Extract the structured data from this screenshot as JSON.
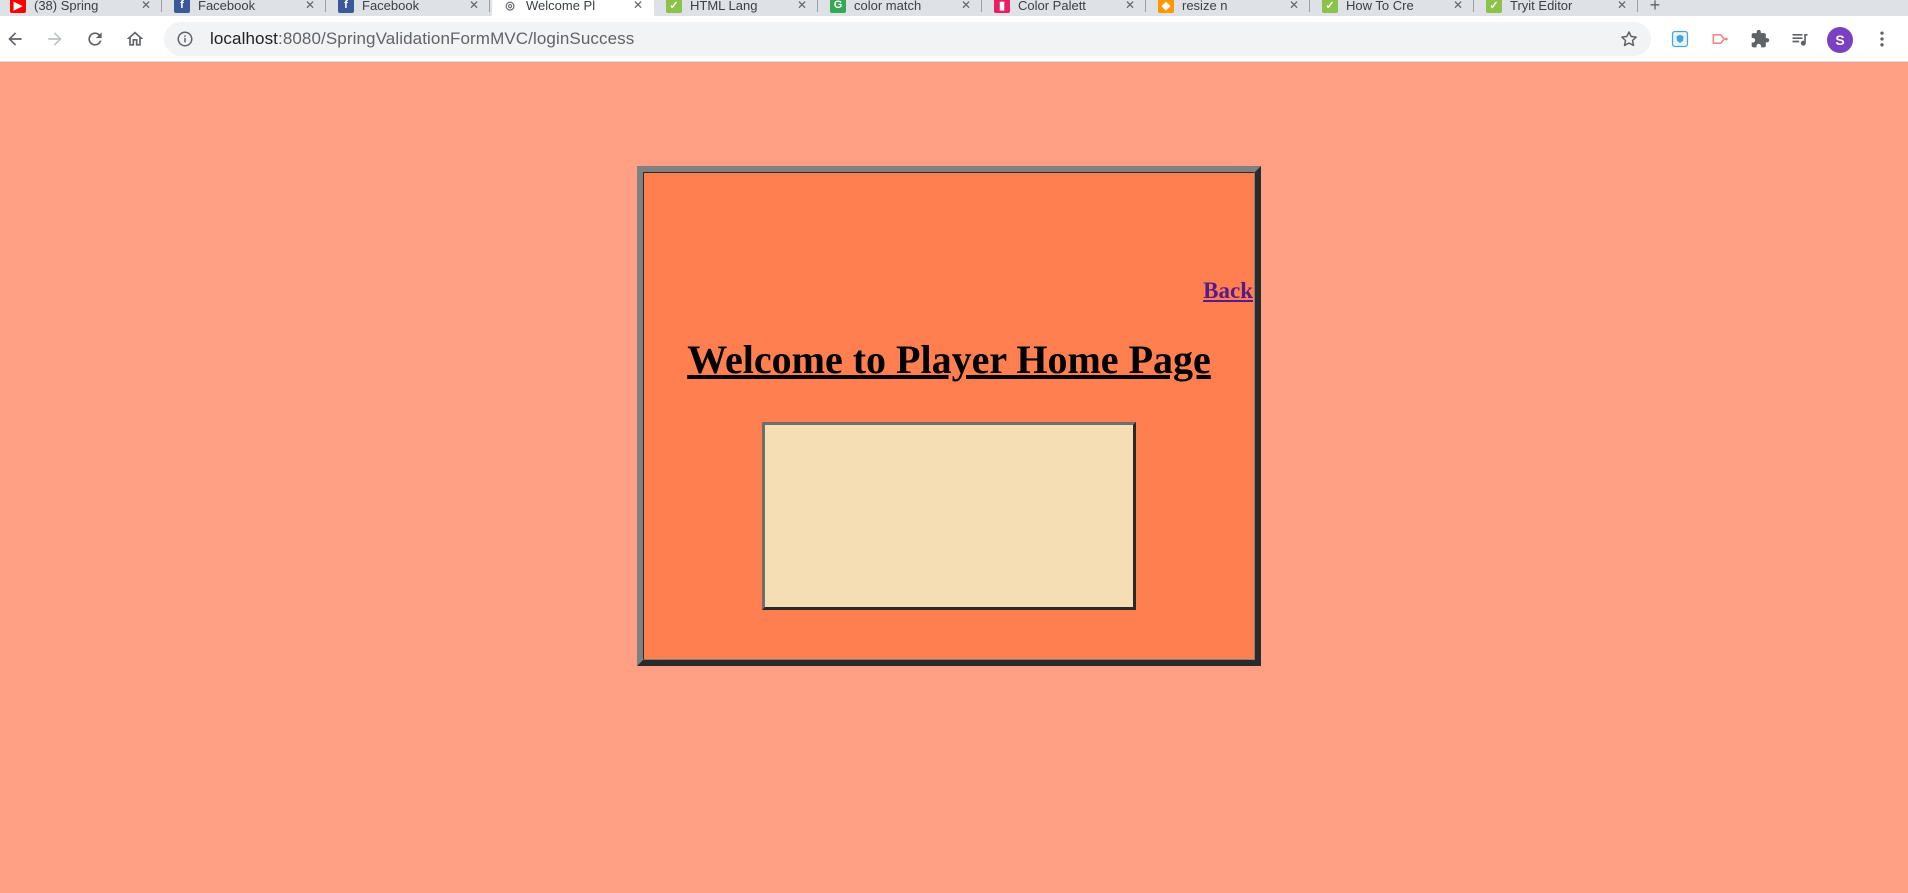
{
  "browser": {
    "tabs": [
      {
        "title": "(38) Spring",
        "favicon": "youtube-icon",
        "color": "#ff0000",
        "glyph": "▶",
        "active": false
      },
      {
        "title": "Facebook",
        "favicon": "facebook-icon",
        "color": "#3b5998",
        "glyph": "f",
        "active": false
      },
      {
        "title": "Facebook",
        "favicon": "facebook-icon",
        "color": "#3b5998",
        "glyph": "f",
        "active": false
      },
      {
        "title": "Welcome Pl",
        "favicon": "globe-icon",
        "color": "#5f6368",
        "glyph": "◎",
        "active": true
      },
      {
        "title": "HTML Lang",
        "favicon": "w3schools-icon",
        "color": "#8bc34a",
        "glyph": "✓",
        "active": false
      },
      {
        "title": "color match",
        "favicon": "google-icon",
        "color": "#34a853",
        "glyph": "G",
        "active": false
      },
      {
        "title": "Color Palett",
        "favicon": "palette-icon",
        "color": "#e91e63",
        "glyph": "▮",
        "active": false
      },
      {
        "title": "resize n",
        "favicon": "firebase-icon",
        "color": "#ff9800",
        "glyph": "◆",
        "active": false
      },
      {
        "title": "How To Cre",
        "favicon": "w3schools-icon",
        "color": "#8bc34a",
        "glyph": "✓",
        "active": false
      },
      {
        "title": "Tryit Editor",
        "favicon": "w3schools-icon",
        "color": "#8bc34a",
        "glyph": "✓",
        "active": false
      }
    ],
    "new_tab_symbol": "+",
    "close_symbol": "✕",
    "address": {
      "host": "localhost",
      "path": ":8080/SpringValidationFormMVC/loginSuccess"
    },
    "profile_initial": "S"
  },
  "page": {
    "back_label": "Back",
    "title": "Welcome to Player Home Page"
  },
  "colors": {
    "page_background": "#ffa085",
    "panel_background": "#ff7f50",
    "content_box_background": "#f5deb3",
    "visited_link": "#551a8b"
  }
}
